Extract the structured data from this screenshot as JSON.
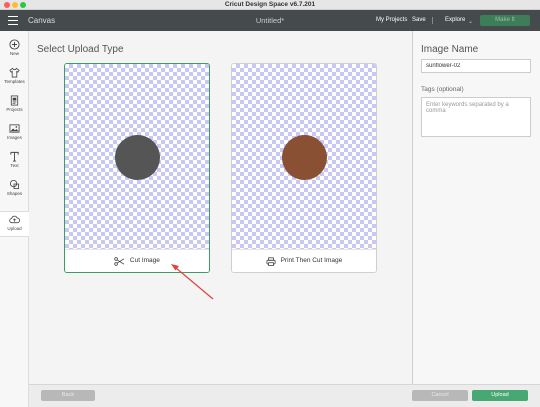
{
  "window": {
    "title": "Cricut Design Space  v6.7.201"
  },
  "topbar": {
    "section": "Canvas",
    "doc_title": "Untitled*",
    "my_projects": "My Projects",
    "save": "Save",
    "explore": "Explore",
    "make_it": "Make It"
  },
  "nav": {
    "items": [
      {
        "label": "New",
        "icon": "plus-circle-icon"
      },
      {
        "label": "Templates",
        "icon": "shirt-icon"
      },
      {
        "label": "Projects",
        "icon": "projects-icon"
      },
      {
        "label": "Images",
        "icon": "image-icon"
      },
      {
        "label": "Text",
        "icon": "text-icon"
      },
      {
        "label": "Shapes",
        "icon": "shapes-icon"
      },
      {
        "label": "Upload",
        "icon": "upload-cloud-icon"
      }
    ],
    "active": "Upload"
  },
  "main": {
    "title": "Select Upload Type",
    "options": [
      {
        "label": "Cut Image",
        "icon": "scissors-icon",
        "preview_color": "#555555",
        "selected": true
      },
      {
        "label": "Print Then Cut Image",
        "icon": "printer-icon",
        "preview_color": "#8a5033",
        "selected": false
      }
    ]
  },
  "panel": {
    "title": "Image Name",
    "name_value": "sunflower-02",
    "tags_label": "Tags (optional)",
    "tags_placeholder": "Enter keywords separated by a comma"
  },
  "footer": {
    "back": "Back",
    "cancel": "Cancel",
    "upload": "Upload"
  },
  "colors": {
    "accent_green": "#47a873",
    "topbar": "#454a4d",
    "checker": "#c9c7f3",
    "annotation_arrow": "#e0433a"
  }
}
